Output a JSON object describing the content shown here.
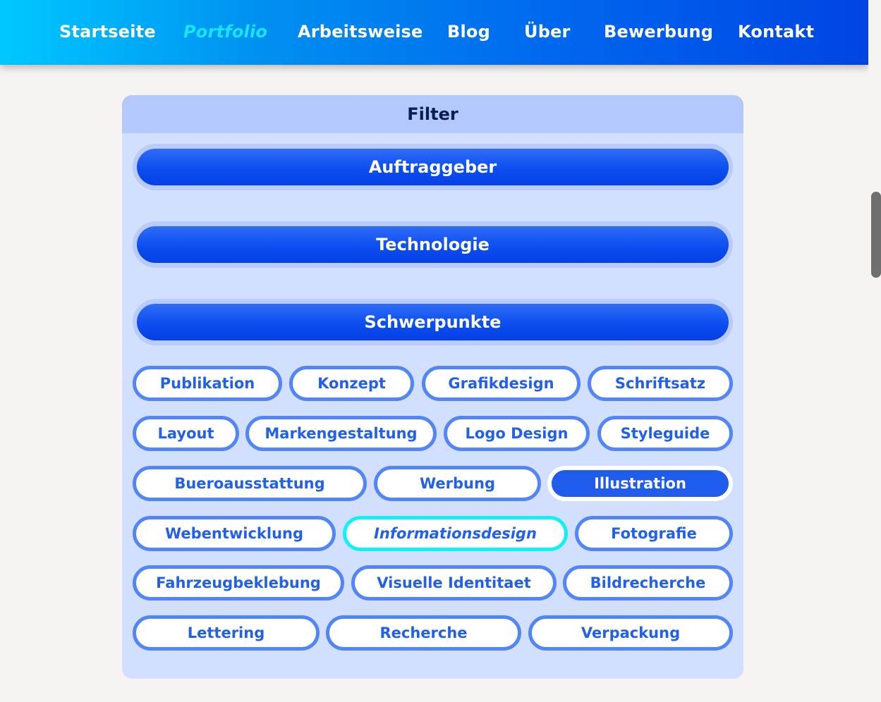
{
  "nav": {
    "items": [
      {
        "label": "Startseite"
      },
      {
        "label": "Portfolio"
      },
      {
        "label": "Arbeitsweise"
      },
      {
        "label": "Blog"
      },
      {
        "label": "Über"
      },
      {
        "label": "Bewerbung"
      },
      {
        "label": "Kontakt"
      }
    ],
    "active": "Portfolio"
  },
  "filter": {
    "title": "Filter",
    "sections": [
      {
        "label": "Auftraggeber"
      },
      {
        "label": "Technologie"
      },
      {
        "label": "Schwerpunkte"
      }
    ],
    "tags": [
      {
        "label": "Publikation"
      },
      {
        "label": "Konzept"
      },
      {
        "label": "Grafikdesign"
      },
      {
        "label": "Schriftsatz"
      },
      {
        "label": "Layout"
      },
      {
        "label": "Markengestaltung"
      },
      {
        "label": "Logo Design"
      },
      {
        "label": "Styleguide"
      },
      {
        "label": "Bueroausstattung"
      },
      {
        "label": "Werbung"
      },
      {
        "label": "Illustration"
      },
      {
        "label": "Webentwicklung"
      },
      {
        "label": "Informationsdesign"
      },
      {
        "label": "Fotografie"
      },
      {
        "label": "Fahrzeugbeklebung"
      },
      {
        "label": "Visuelle Identitaet"
      },
      {
        "label": "Bildrecherche"
      },
      {
        "label": "Lettering"
      },
      {
        "label": "Recherche"
      },
      {
        "label": "Verpackung"
      }
    ],
    "selected_tag": "Illustration",
    "focused_tag": "Informationsdesign"
  },
  "colors": {
    "nav_gradient_start": "#00c8ff",
    "nav_gradient_end": "#0044e4",
    "nav_active": "#18e4ff",
    "panel_bg": "#d2dfff",
    "panel_header_bg": "#b3c8fd",
    "accent_blue": "#1f5cec",
    "tag_border": "#5285f6",
    "focus_ring": "#10f1f6"
  }
}
